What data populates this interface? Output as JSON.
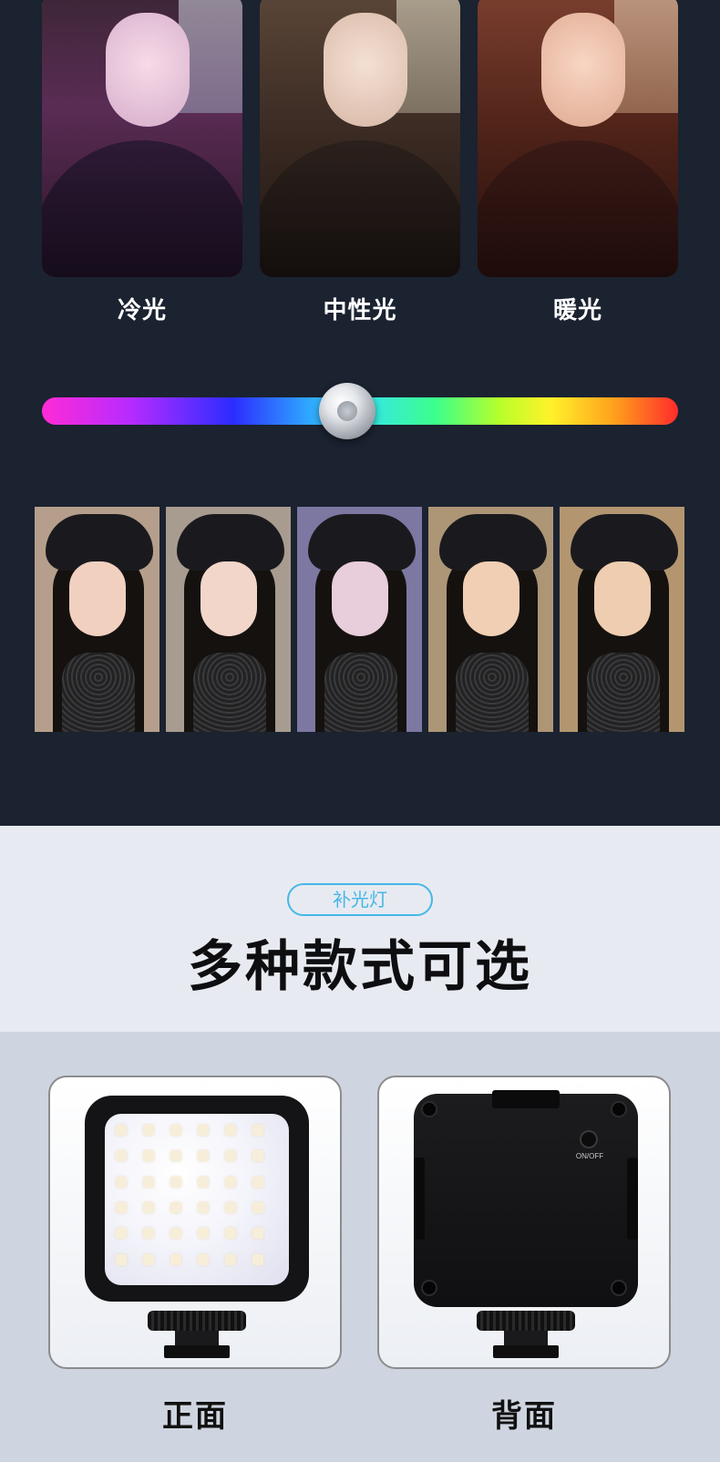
{
  "top_photos": {
    "cool_label": "冷光",
    "neutral_label": "中性光",
    "warm_label": "暖光"
  },
  "slider": {
    "value": 0.48
  },
  "header": {
    "badge": "补光灯",
    "title": "多种款式可选"
  },
  "products": {
    "front_label": "正面",
    "back_label": "背面",
    "back_button_text": "ON/OFF"
  },
  "colors": {
    "background_dark": "#1b2230",
    "accent_blue": "#46b6e8",
    "header_band": "#e7ebf1",
    "product_band": "#ced5e0"
  }
}
